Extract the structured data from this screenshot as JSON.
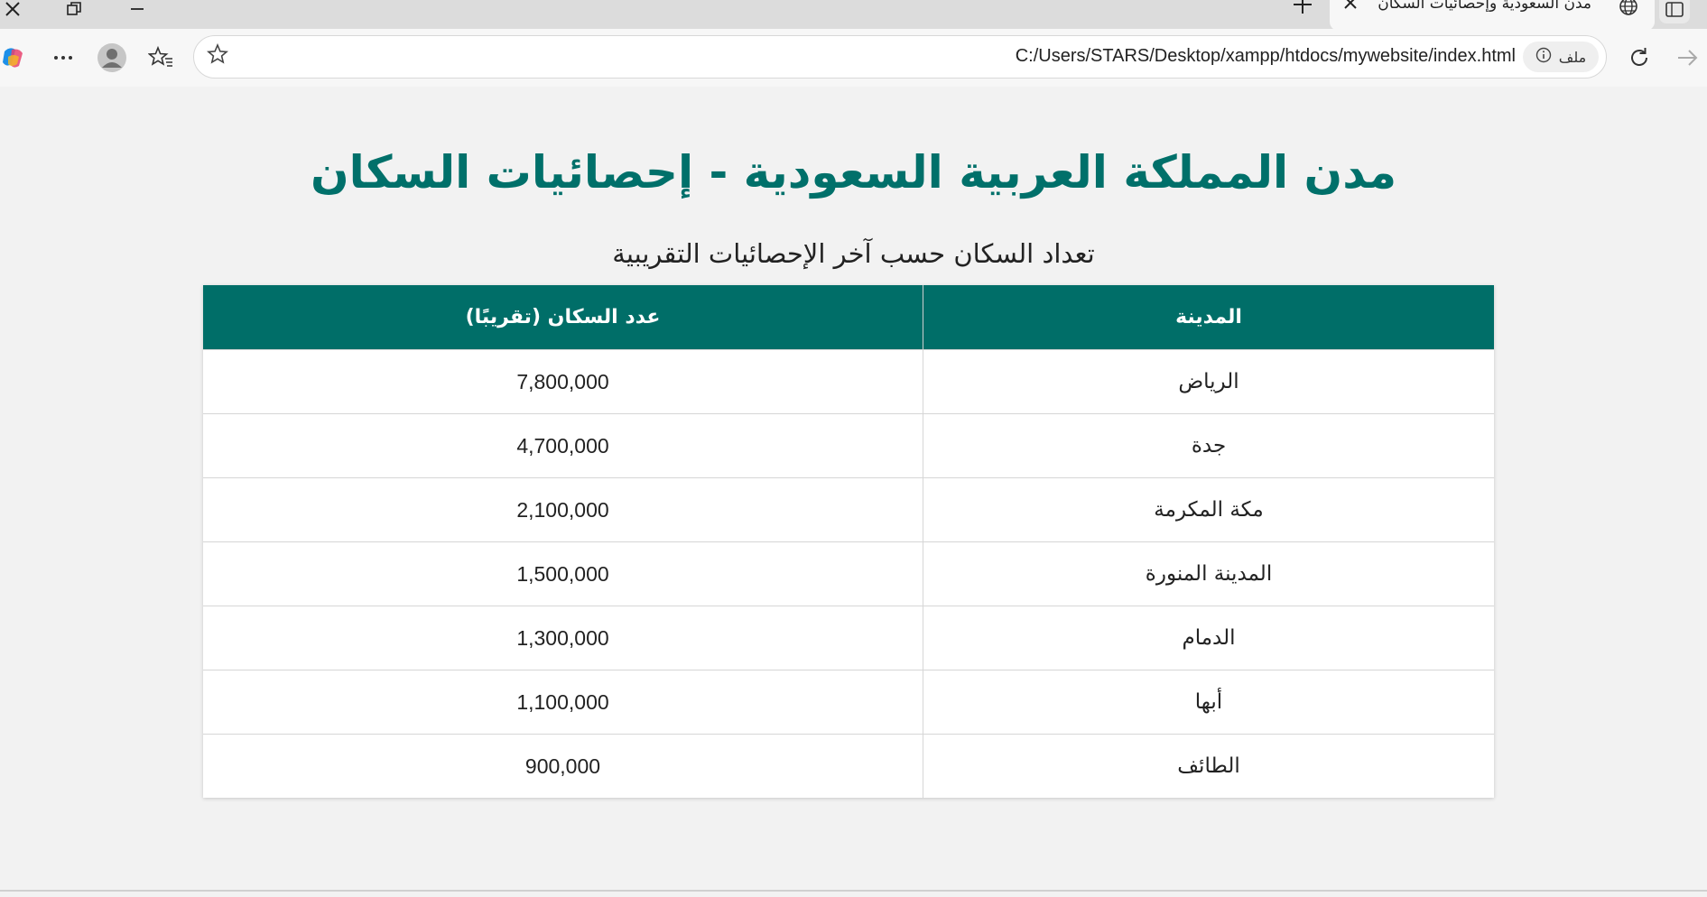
{
  "browser": {
    "tab_title": "مدن السعودية وإحصائيات السكان",
    "address_url": "C:/Users/STARS/Desktop/xampp/htdocs/mywebsite/index.html",
    "file_chip_label": "ملف",
    "icons": {
      "window_close": "close-icon",
      "restore": "restore-icon",
      "minimize": "minimize-icon",
      "new_tab": "plus-icon",
      "tab_close": "close-icon",
      "tab_site": "globe-icon",
      "copilot": "copilot-icon",
      "more": "more-icon",
      "profile": "avatar",
      "favorites": "favorites-icon",
      "add_favorite": "star-icon",
      "site_info": "info-icon",
      "refresh": "refresh-icon",
      "forward": "forward-arrow-icon"
    }
  },
  "page": {
    "title": "مدن المملكة العربية السعودية - إحصائيات السكان",
    "caption": "تعداد السكان حسب آخر الإحصائيات التقريبية",
    "accent_color": "#00706a",
    "table": {
      "headers": {
        "city": "المدينة",
        "population": "عدد السكان (تقريبًا)"
      },
      "rows": [
        {
          "city": "الرياض",
          "population": "7,800,000"
        },
        {
          "city": "جدة",
          "population": "4,700,000"
        },
        {
          "city": "مكة المكرمة",
          "population": "2,100,000"
        },
        {
          "city": "المدينة المنورة",
          "population": "1,500,000"
        },
        {
          "city": "الدمام",
          "population": "1,300,000"
        },
        {
          "city": "أبها",
          "population": "1,100,000"
        },
        {
          "city": "الطائف",
          "population": "900,000"
        }
      ]
    }
  }
}
